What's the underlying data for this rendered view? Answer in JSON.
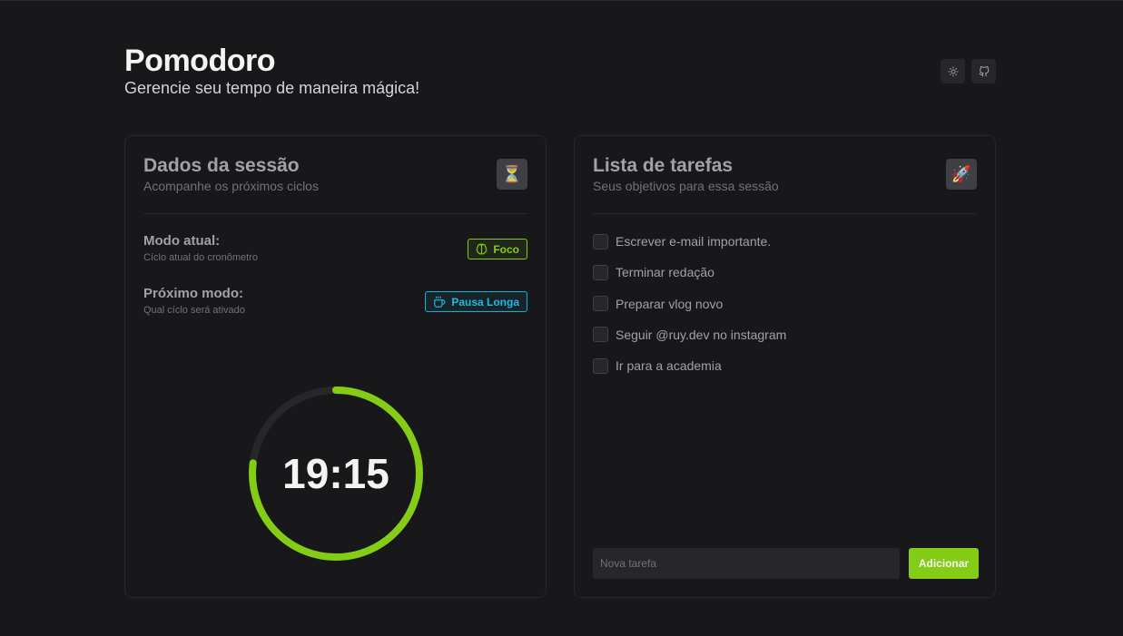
{
  "app": {
    "title": "Pomodoro",
    "subtitle": "Gerencie seu tempo de maneira mágica!",
    "actions": [
      {
        "icon": "sun-icon"
      },
      {
        "icon": "github-icon"
      }
    ]
  },
  "session": {
    "title": "Dados da sessão",
    "description": "Acompanhe os próximos ciclos",
    "emoji": "⏳",
    "current_mode": {
      "label": "Modo atual:",
      "sub": "Cíclo atual do cronômetro",
      "badge": "Foco",
      "badge_icon": "brain-icon"
    },
    "next_mode": {
      "label": "Próximo modo:",
      "sub": "Qual cíclo será ativado",
      "badge": "Pausa Longa",
      "badge_icon": "coffee-icon"
    },
    "timer": {
      "display": "19:15",
      "progress": 0.77
    }
  },
  "tasks": {
    "title": "Lista de tarefas",
    "description": "Seus objetivos para essa sessão",
    "emoji": "🚀",
    "items": [
      {
        "label": "Escrever e-mail importante.",
        "done": false
      },
      {
        "label": "Terminar redação",
        "done": false
      },
      {
        "label": "Preparar vlog novo",
        "done": false
      },
      {
        "label": "Seguir @ruy.dev no instagram",
        "done": false
      },
      {
        "label": "Ir para a academia",
        "done": false
      }
    ],
    "input_placeholder": "Nova tarefa",
    "input_value": "",
    "add_label": "Adicionar"
  },
  "colors": {
    "background": "#18181b",
    "accent": "#84cc16",
    "cyan": "#06b6d4",
    "track": "#27272a"
  }
}
